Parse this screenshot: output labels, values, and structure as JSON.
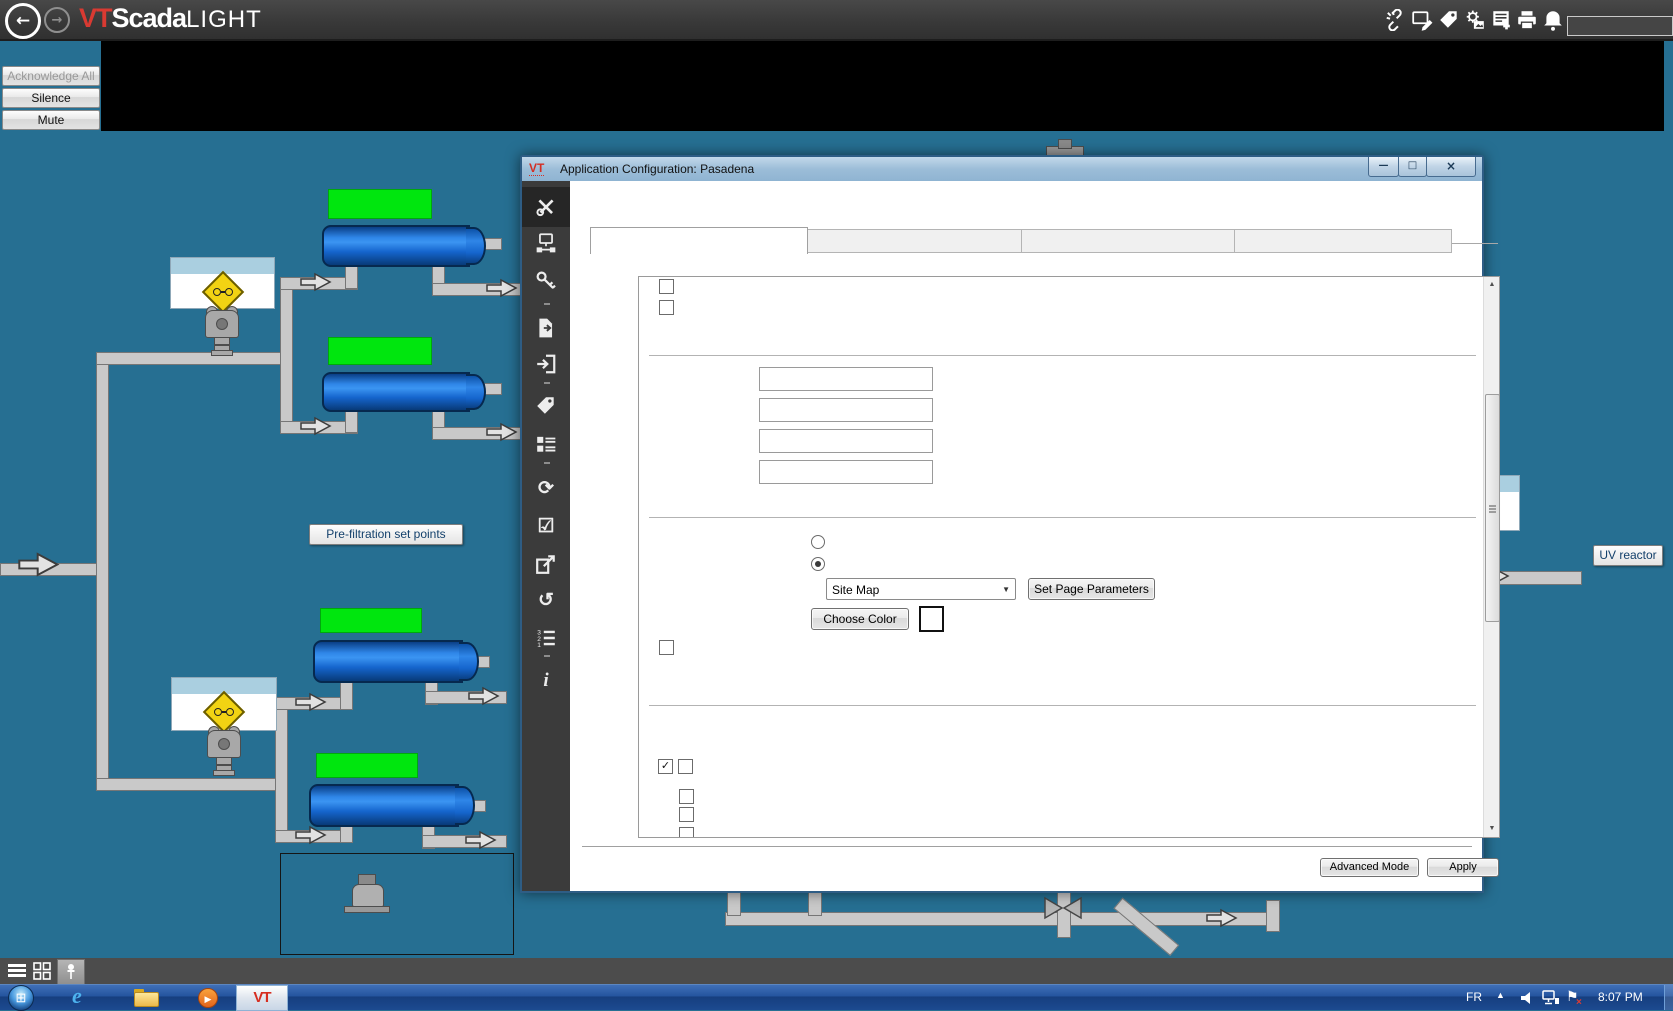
{
  "topbar": {
    "logo_vt": "VT",
    "logo_scada": "Scada",
    "logo_light": "LIGHT"
  },
  "alarm_panel": {
    "acknowledge_all": "Acknowledge All",
    "silence": "Silence",
    "mute": "Mute"
  },
  "diagram": {
    "prefiltration_label": "Pre-filtration set points",
    "uv_reactor_label": "UV reactor"
  },
  "dialog": {
    "badge": "VT",
    "title": "Application Configuration: Pasadena",
    "tabs": [
      "",
      "",
      "",
      ""
    ],
    "form": {
      "dropdown_value": "Site Map",
      "set_page_parameters": "Set Page Parameters",
      "choose_color": "Choose Color"
    },
    "footer": {
      "advanced_mode": "Advanced Mode",
      "apply": "Apply"
    }
  },
  "taskbar": {
    "language": "FR",
    "time": "8:07 PM",
    "vt_app_label": "VT",
    "ie_glyph": "e"
  },
  "icons": {
    "back": "←",
    "forward": "→",
    "minimize": "—",
    "maximize": "□",
    "close": "×",
    "check": "✓",
    "dropdown_arrow": "▼",
    "scroll_up": "▲",
    "scroll_down": "▼",
    "refresh": "⟳",
    "tasks": "☑",
    "undo": "↺",
    "info": "i",
    "start": "⊞",
    "play": "▶",
    "flag": "⚑",
    "tray_up": "▲"
  },
  "colors": {
    "background_teal": "#266f92",
    "status_green": "#00e60e",
    "tank_blue": "#1565cd",
    "taskbar_blue": "#24549e",
    "alarm_black": "#000000",
    "logo_red": "#d93a32"
  }
}
